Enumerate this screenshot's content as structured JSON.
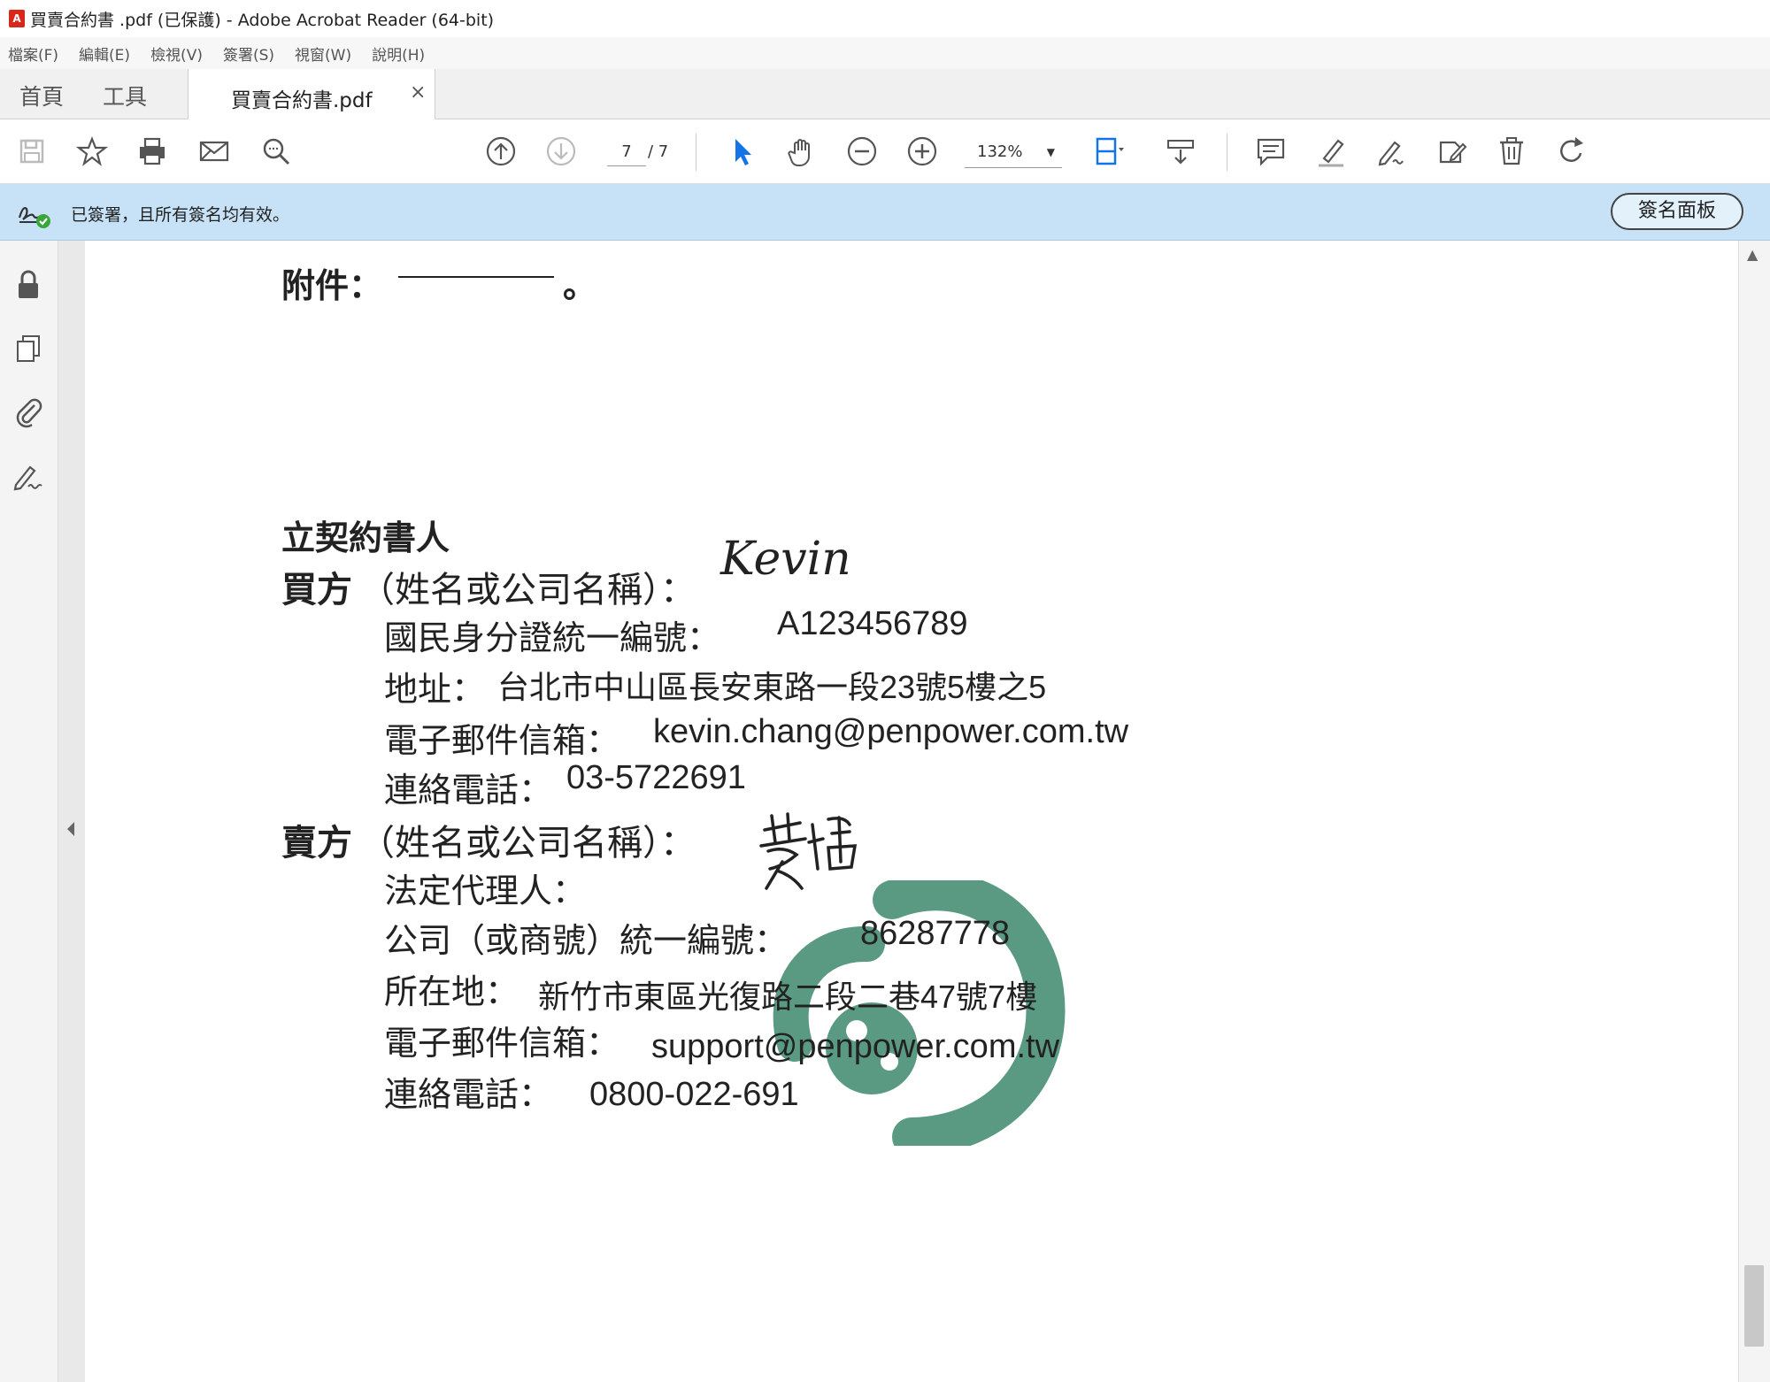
{
  "window": {
    "title": "買賣合約書 .pdf (已保護) - Adobe Acrobat Reader (64-bit)"
  },
  "menu": [
    "檔案(F)",
    "編輯(E)",
    "檢視(V)",
    "簽署(S)",
    "視窗(W)",
    "說明(H)"
  ],
  "tabs": {
    "home": "首頁",
    "tools": "工具",
    "document": "買賣合約書.pdf"
  },
  "toolbar": {
    "current_page": "7",
    "total_pages": "/ 7",
    "zoom": "132%"
  },
  "signature_bar": {
    "status": "已簽署，且所有簽名均有效。",
    "panel_button": "簽名面板"
  },
  "document": {
    "attachment_label": "附件：",
    "attachment_blank": "",
    "attachment_end": "。",
    "parties_heading": "立契約書人",
    "buyer": {
      "label": "買方",
      "name_label": "（姓名或公司名稱）：",
      "signature": "Kevin",
      "id_label": "國民身分證統一編號：",
      "id_value": "A123456789",
      "address_label": "地址：",
      "address_value": "台北市中山區長安東路一段23號5樓之5",
      "email_label": "電子郵件信箱：",
      "email_value": "kevin.chang@penpower.com.tw",
      "phone_label": "連絡電話：",
      "phone_value": "03-5722691"
    },
    "seller": {
      "label": "賣方",
      "name_label": "（姓名或公司名稱）：",
      "signature": "慕恬",
      "rep_label": "法定代理人：",
      "company_id_label": "公司（或商號）統一編號：",
      "company_id_value": "86287778",
      "location_label": "所在地：",
      "location_value": "新竹市東區光復路二段二巷47號7樓",
      "email_label": "電子郵件信箱：",
      "email_value": "support@penpower.com.tw",
      "phone_label": "連絡電話：",
      "phone_value": "0800-022-691"
    }
  },
  "colors": {
    "signature_bar": "#c7e2f7",
    "stamp": "#5a9a82",
    "accent_blue": "#1473e6"
  }
}
